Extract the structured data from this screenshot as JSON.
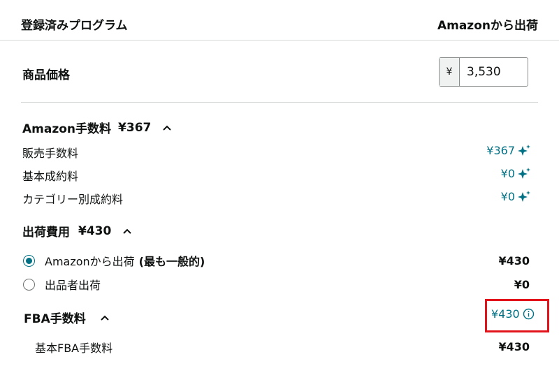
{
  "header": {
    "left_title": "登録済みプログラム",
    "right_title": "Amazonから出荷"
  },
  "price": {
    "label": "商品価格",
    "currency": "¥",
    "value": "3,530"
  },
  "amazon_fees": {
    "title": "Amazon手数料",
    "total": "¥367",
    "items": [
      {
        "label": "販売手数料",
        "value": "¥367"
      },
      {
        "label": "基本成約料",
        "value": "¥0"
      },
      {
        "label": "カテゴリー別成約料",
        "value": "¥0"
      }
    ]
  },
  "shipping": {
    "title": "出荷費用",
    "total": "¥430",
    "options": [
      {
        "label": "Amazonから出荷",
        "note": "(最も一般的)",
        "value": "¥430",
        "selected": true
      },
      {
        "label": "出品者出荷",
        "value": "¥0",
        "selected": false
      }
    ]
  },
  "fba": {
    "title": "FBA手数料",
    "total": "¥430",
    "items": [
      {
        "label": "基本FBA手数料",
        "value": "¥430"
      }
    ]
  },
  "colors": {
    "accent": "#007185",
    "highlight": "#e3131b"
  }
}
